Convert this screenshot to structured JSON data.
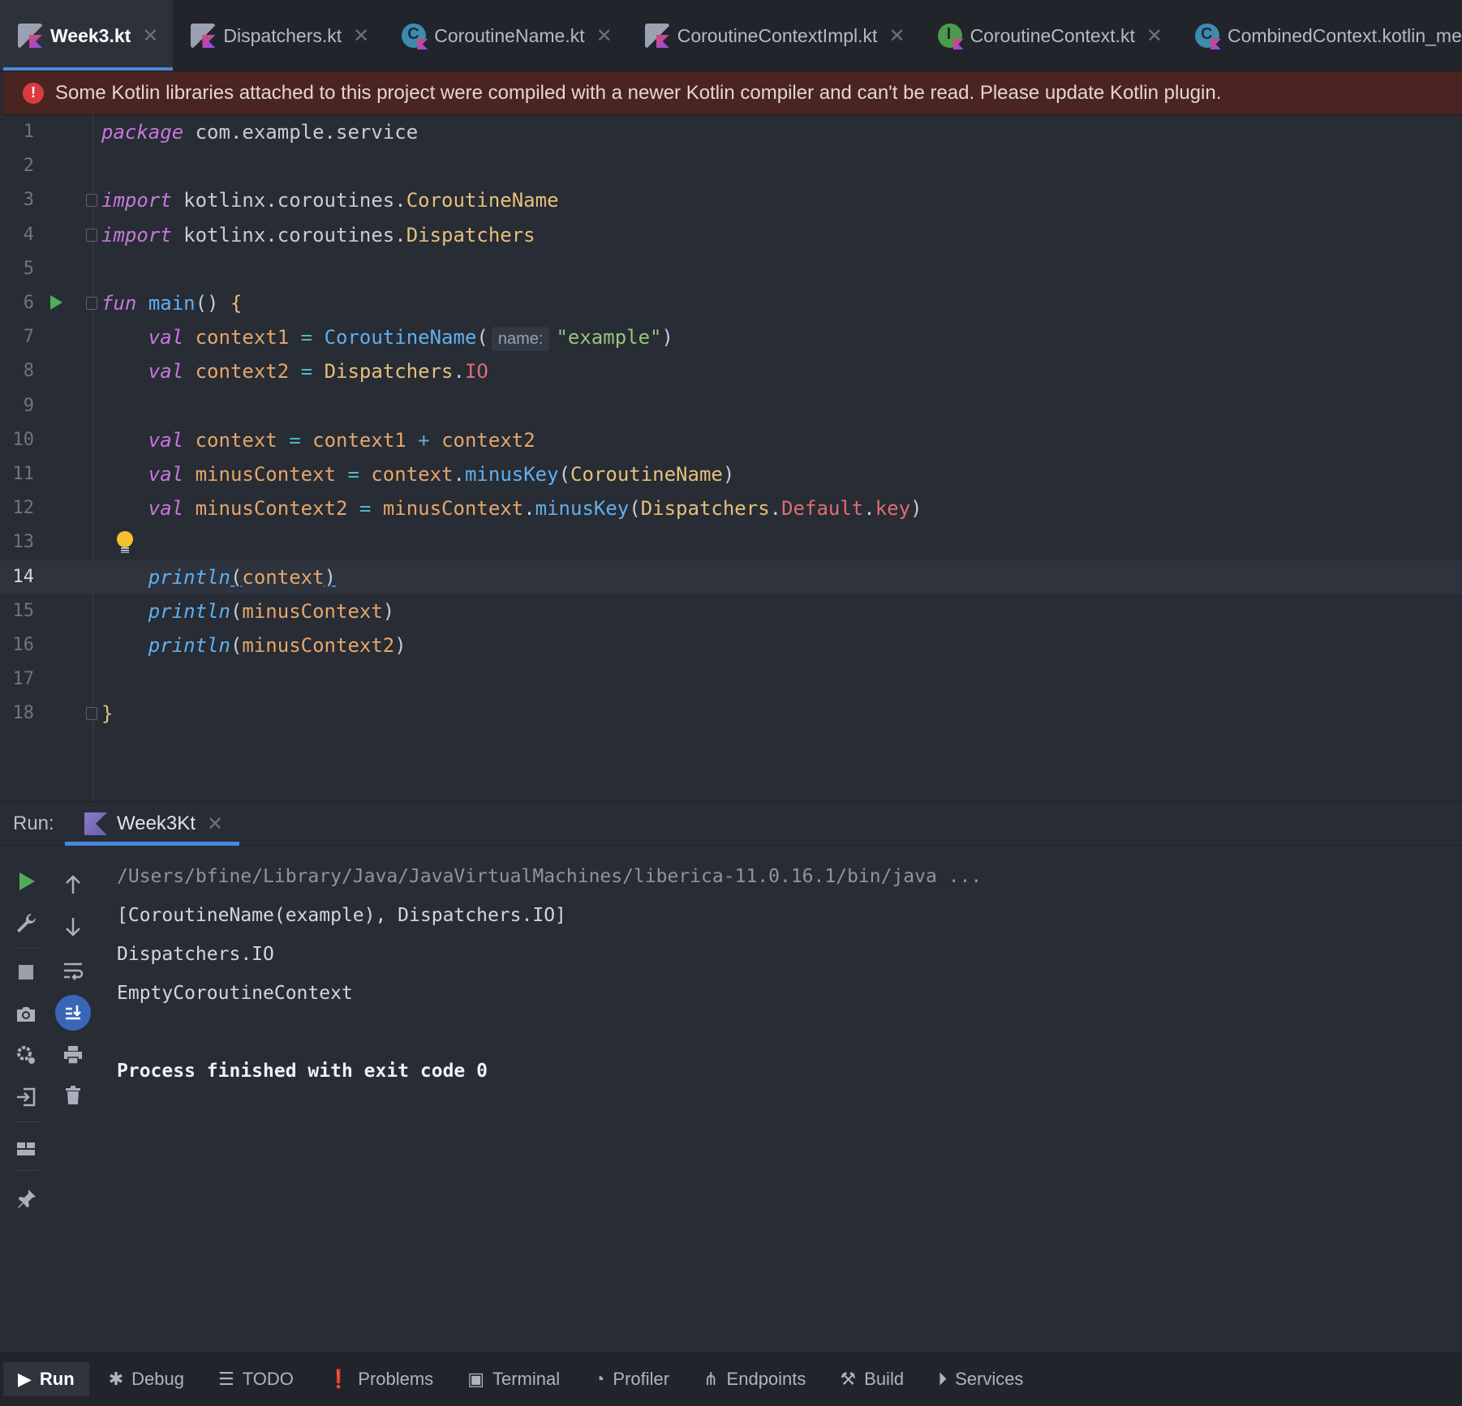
{
  "tabs": [
    {
      "label": "Week3.kt",
      "icon": "kotlin-file-icon",
      "active": true
    },
    {
      "label": "Dispatchers.kt",
      "icon": "kotlin-file-icon",
      "active": false
    },
    {
      "label": "CoroutineName.kt",
      "icon": "class-icon",
      "active": false
    },
    {
      "label": "CoroutineContextImpl.kt",
      "icon": "kotlin-file-icon",
      "active": false
    },
    {
      "label": "CoroutineContext.kt",
      "icon": "interface-icon",
      "active": false
    },
    {
      "label": "CombinedContext.kotlin_metadata",
      "icon": "class-icon",
      "active": false
    }
  ],
  "banner": {
    "message": "Some Kotlin libraries attached to this project were compiled with a newer Kotlin compiler and can't be read. Please update Kotlin plugin.",
    "icon": "error-icon",
    "color": "#4a2420"
  },
  "editor": {
    "current_line": 14,
    "line_numbers": [
      "1",
      "2",
      "3",
      "4",
      "5",
      "6",
      "7",
      "8",
      "9",
      "10",
      "11",
      "12",
      "13",
      "14",
      "15",
      "16",
      "17",
      "18"
    ],
    "lines": [
      [
        [
          "kw",
          "package"
        ],
        [
          "pu",
          " com.example.service"
        ]
      ],
      [],
      [
        [
          "kw",
          "import"
        ],
        [
          "pu",
          " kotlinx.coroutines."
        ],
        [
          "ty",
          "CoroutineName"
        ]
      ],
      [
        [
          "kw",
          "import"
        ],
        [
          "pu",
          " kotlinx.coroutines."
        ],
        [
          "ty",
          "Dispatchers"
        ]
      ],
      [],
      [
        [
          "kw",
          "fun"
        ],
        [
          "pu",
          " "
        ],
        [
          "fn",
          "main"
        ],
        [
          "pu",
          "() "
        ],
        [
          "brace",
          "{"
        ]
      ],
      [
        [
          "pu",
          "    "
        ],
        [
          "kw",
          "val"
        ],
        [
          "pu",
          " "
        ],
        [
          "var",
          "context1"
        ],
        [
          "pu",
          " "
        ],
        [
          "op",
          "="
        ],
        [
          "pu",
          " "
        ],
        [
          "fn",
          "CoroutineName"
        ],
        [
          "pu",
          "("
        ],
        [
          "hint",
          "name:"
        ],
        [
          "str",
          "\"example\""
        ],
        [
          "pu",
          ")"
        ]
      ],
      [
        [
          "pu",
          "    "
        ],
        [
          "kw",
          "val"
        ],
        [
          "pu",
          " "
        ],
        [
          "var",
          "context2"
        ],
        [
          "pu",
          " "
        ],
        [
          "op",
          "="
        ],
        [
          "pu",
          " "
        ],
        [
          "ty",
          "Dispatchers"
        ],
        [
          "pu",
          "."
        ],
        [
          "prop",
          "IO"
        ]
      ],
      [],
      [
        [
          "pu",
          "    "
        ],
        [
          "kw",
          "val"
        ],
        [
          "pu",
          " "
        ],
        [
          "var",
          "context"
        ],
        [
          "pu",
          " "
        ],
        [
          "op",
          "="
        ],
        [
          "pu",
          " "
        ],
        [
          "var",
          "context1"
        ],
        [
          "pu",
          " "
        ],
        [
          "op",
          "+"
        ],
        [
          "pu",
          " "
        ],
        [
          "var",
          "context2"
        ]
      ],
      [
        [
          "pu",
          "    "
        ],
        [
          "kw",
          "val"
        ],
        [
          "pu",
          " "
        ],
        [
          "var",
          "minusContext"
        ],
        [
          "pu",
          " "
        ],
        [
          "op",
          "="
        ],
        [
          "pu",
          " "
        ],
        [
          "var",
          "context"
        ],
        [
          "pu",
          "."
        ],
        [
          "fn",
          "minusKey"
        ],
        [
          "pu",
          "("
        ],
        [
          "ty",
          "CoroutineName"
        ],
        [
          "pu",
          ")"
        ]
      ],
      [
        [
          "pu",
          "    "
        ],
        [
          "kw",
          "val"
        ],
        [
          "pu",
          " "
        ],
        [
          "var",
          "minusContext2"
        ],
        [
          "pu",
          " "
        ],
        [
          "op",
          "="
        ],
        [
          "pu",
          " "
        ],
        [
          "var",
          "minusContext"
        ],
        [
          "pu",
          "."
        ],
        [
          "fn",
          "minusKey"
        ],
        [
          "pu",
          "("
        ],
        [
          "ty",
          "Dispatchers"
        ],
        [
          "pu",
          "."
        ],
        [
          "prop",
          "Default"
        ],
        [
          "pu",
          "."
        ],
        [
          "prop",
          "key"
        ],
        [
          "pu",
          ")"
        ]
      ],
      [],
      [
        [
          "pu",
          "    "
        ],
        [
          "itfn",
          "println"
        ],
        [
          "ul",
          "("
        ],
        [
          "var",
          "context"
        ],
        [
          "ul",
          ")"
        ]
      ],
      [
        [
          "pu",
          "    "
        ],
        [
          "itfn",
          "println"
        ],
        [
          "pu",
          "("
        ],
        [
          "var",
          "minusContext"
        ],
        [
          "pu",
          ")"
        ]
      ],
      [
        [
          "pu",
          "    "
        ],
        [
          "itfn",
          "println"
        ],
        [
          "pu",
          "("
        ],
        [
          "var",
          "minusContext2"
        ],
        [
          "pu",
          ")"
        ]
      ],
      [],
      [
        [
          "brace",
          "}"
        ]
      ]
    ]
  },
  "run": {
    "label": "Run:",
    "tab_label": "Week3Kt",
    "output": [
      "/Users/bfine/Library/Java/JavaVirtualMachines/liberica-11.0.16.1/bin/java ...",
      "[CoroutineName(example), Dispatchers.IO]",
      "Dispatchers.IO",
      "EmptyCoroutineContext",
      "",
      "Process finished with exit code 0"
    ]
  },
  "bottom_tools": [
    {
      "label": "Run",
      "icon": "play-icon",
      "active": true
    },
    {
      "label": "Debug",
      "icon": "bug-icon",
      "active": false
    },
    {
      "label": "TODO",
      "icon": "list-icon",
      "active": false
    },
    {
      "label": "Problems",
      "icon": "alert-icon",
      "active": false
    },
    {
      "label": "Terminal",
      "icon": "terminal-icon",
      "active": false
    },
    {
      "label": "Profiler",
      "icon": "profiler-icon",
      "active": false
    },
    {
      "label": "Endpoints",
      "icon": "endpoints-icon",
      "active": false
    },
    {
      "label": "Build",
      "icon": "hammer-icon",
      "active": false
    },
    {
      "label": "Services",
      "icon": "services-icon",
      "active": false
    }
  ],
  "colors": {
    "accent": "#4a88dd",
    "keyword": "#c678dd",
    "type": "#e5c07b",
    "function": "#61afef",
    "string": "#98c379",
    "property": "#e06c75",
    "run_green": "#4ead5b"
  }
}
